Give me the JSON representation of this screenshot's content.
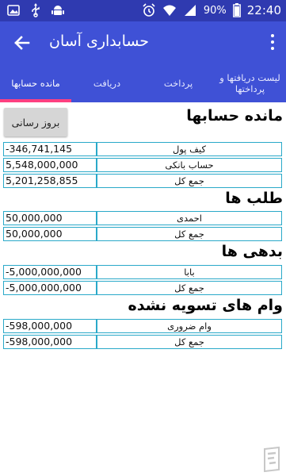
{
  "status_bar": {
    "battery": "90%",
    "time": "22:40",
    "icons": [
      "gallery-icon",
      "usb-icon",
      "android-debug-icon",
      "alarm-icon",
      "wifi-icon",
      "signal-icon",
      "battery-icon"
    ]
  },
  "app_bar": {
    "title": "حسابداری آسان",
    "back_icon": "arrow-back-icon",
    "menu_icon": "more-vert-icon"
  },
  "tabs": [
    {
      "label": "مانده حسابها",
      "active": true
    },
    {
      "label": "دریافت",
      "active": false
    },
    {
      "label": "پرداخت",
      "active": false
    },
    {
      "label": "لیست دریافتها و پرداختها",
      "active": false
    }
  ],
  "refresh_button": "بروز رسانی",
  "sections": [
    {
      "title": "مانده حسابها",
      "rows": [
        {
          "label": "کیف پول",
          "amount": "-346,741,145"
        },
        {
          "label": "حساب بانکی",
          "amount": "5,548,000,000"
        },
        {
          "label": "جمع کل",
          "amount": "5,201,258,855"
        }
      ]
    },
    {
      "title": "طلب ها",
      "rows": [
        {
          "label": "احمدی",
          "amount": "50,000,000"
        },
        {
          "label": "جمع کل",
          "amount": "50,000,000"
        }
      ]
    },
    {
      "title": "بدهی ها",
      "rows": [
        {
          "label": "بابا",
          "amount": "-5,000,000,000"
        },
        {
          "label": "جمع کل",
          "amount": "-5,000,000,000"
        }
      ]
    },
    {
      "title": "وام های تسویه نشده",
      "rows": [
        {
          "label": "وام ضروری",
          "amount": "-598,000,000"
        },
        {
          "label": "جمع کل",
          "amount": "-598,000,000"
        }
      ]
    }
  ],
  "colors": {
    "status_bar": "#2f3ab0",
    "app_bar": "#3f51d6",
    "tab_indicator": "#ff4081",
    "cell_border": "#2aa9c9"
  }
}
